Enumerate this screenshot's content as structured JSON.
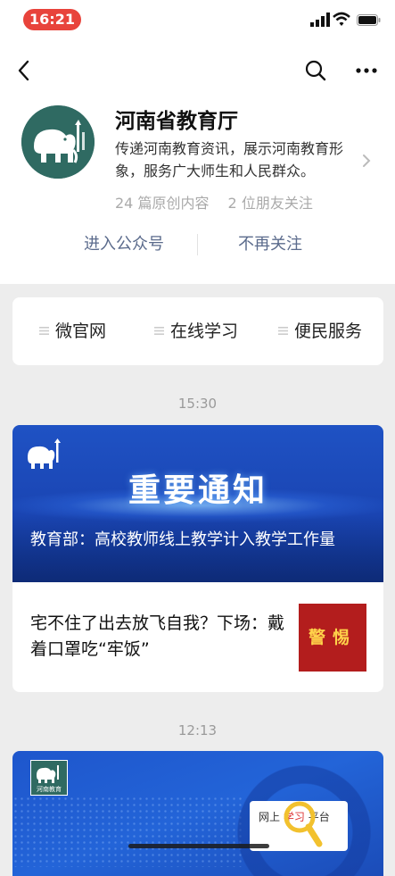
{
  "status_bar": {
    "time": "16:21",
    "icons": [
      "cellular-signal-icon",
      "wifi-icon",
      "battery-icon"
    ]
  },
  "nav": {
    "back_icon": "chevron-left-icon",
    "search_icon": "search-icon",
    "more_icon": "ellipsis-icon"
  },
  "account": {
    "name": "河南省教育厅",
    "description": "传递河南教育资讯，展示河南教育形象，服务广大师生和人民群众。",
    "stats": {
      "original_count": "24 篇原创内容",
      "friends_following": "2 位朋友关注"
    },
    "actions": {
      "enter": "进入公众号",
      "unfollow": "不再关注"
    }
  },
  "menu": {
    "items": [
      {
        "label": "微官网"
      },
      {
        "label": "在线学习"
      },
      {
        "label": "便民服务"
      }
    ]
  },
  "feed": [
    {
      "time": "15:30",
      "hero_banner_text": "重要通知",
      "headline": "教育部：高校教师线上教学计入教学工作量",
      "sub_article": {
        "title": "宅不住了出去放飞自我？下场：戴着口罩吃“牢饭”",
        "thumb_text": "警惕"
      }
    },
    {
      "time": "12:13",
      "banner_logo_text": "河南教育",
      "banner_screen_text": {
        "left": "网上",
        "highlight": "学习",
        "right": "平台"
      }
    }
  ],
  "colors": {
    "status_pill": "#e8433b",
    "link_blue_gray": "#5b6b8c",
    "hero_blue": "#1a45b3",
    "avatar_teal": "#2f6a62",
    "thumb_red": "#b31d1d"
  }
}
